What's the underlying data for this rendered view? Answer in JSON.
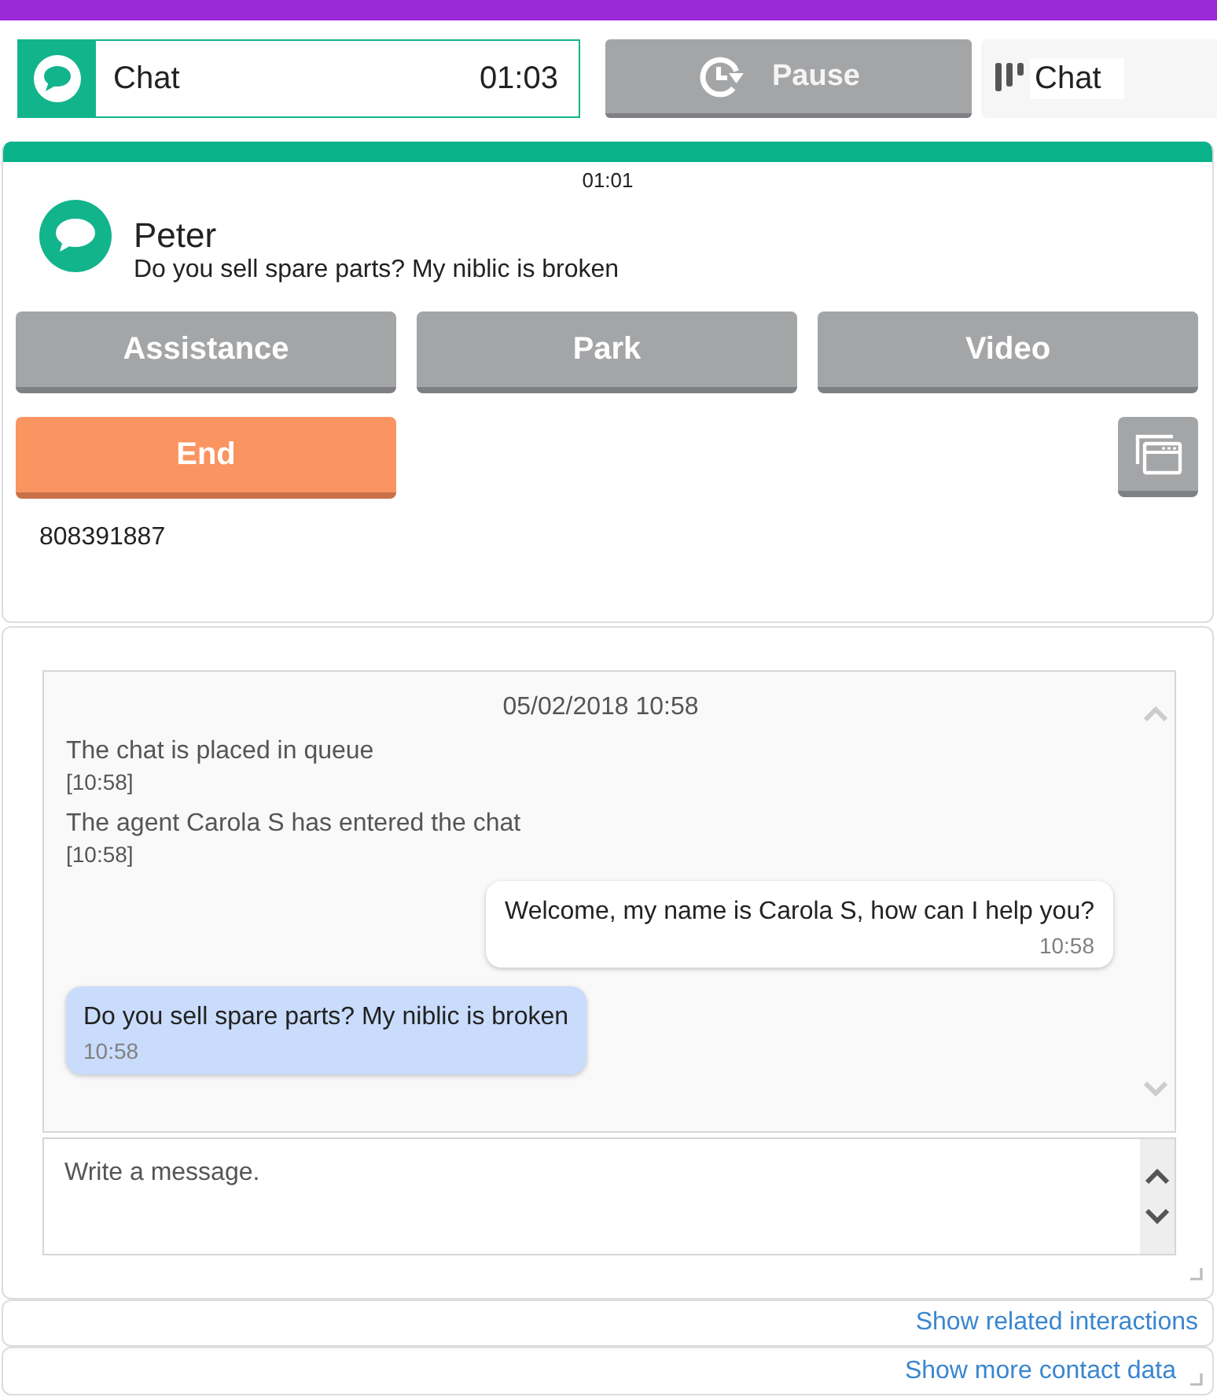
{
  "header": {
    "session": {
      "label": "Chat",
      "timer": "01:03"
    },
    "pause_button": {
      "label": "Pause"
    },
    "channel": {
      "label": "Chat"
    }
  },
  "interaction": {
    "timer": "01:01",
    "contact": {
      "name": "Peter",
      "last_message": "Do you sell spare parts? My niblic is broken"
    },
    "actions": [
      {
        "label": "Assistance",
        "kind": "neutral"
      },
      {
        "label": "Park",
        "kind": "neutral"
      },
      {
        "label": "Video",
        "kind": "neutral"
      },
      {
        "label": "End",
        "kind": "end"
      }
    ],
    "reference": "808391887"
  },
  "transcript": {
    "date": "05/02/2018 10:58",
    "entries": [
      {
        "kind": "system",
        "text": "The chat is placed in queue",
        "time": "[10:58]"
      },
      {
        "kind": "system",
        "text": "The agent Carola S has entered the chat",
        "time": "[10:58]"
      },
      {
        "kind": "agent",
        "text": "Welcome, my name is Carola S, how can I help you?",
        "time": "10:58"
      },
      {
        "kind": "customer",
        "text": "Do you sell spare parts? My niblic is broken",
        "time": "10:58"
      }
    ]
  },
  "composer": {
    "placeholder": "Write a message."
  },
  "links": [
    "Show related interactions",
    "Show more contact data"
  ]
}
